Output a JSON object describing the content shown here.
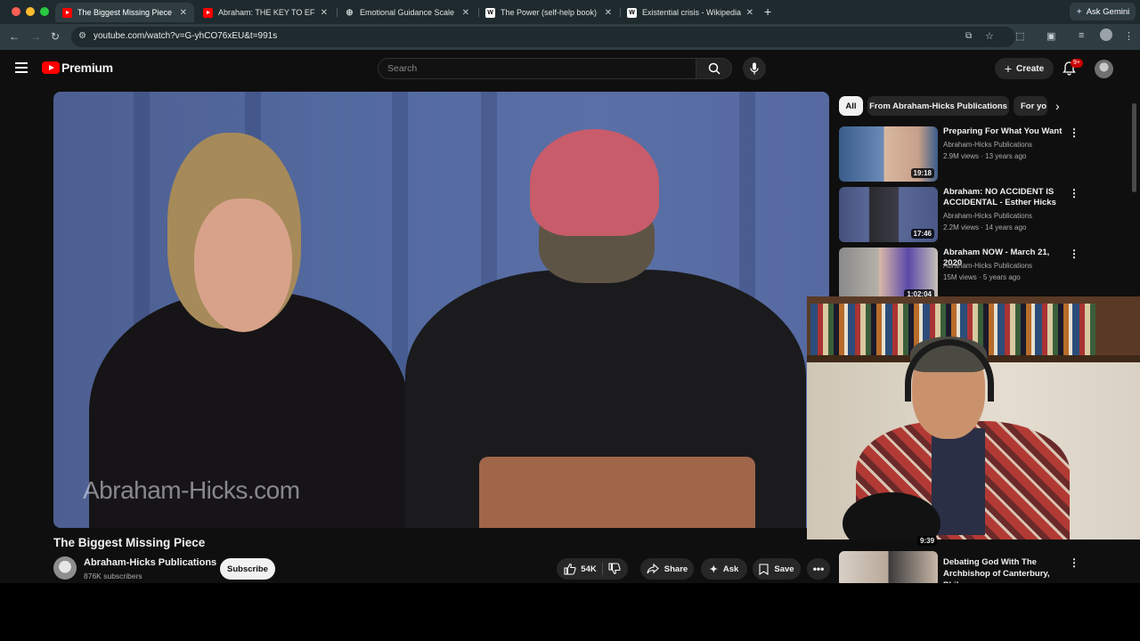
{
  "browser": {
    "tabs": [
      {
        "title": "The Biggest Missing Piece - Y",
        "favicon": "youtube-icon",
        "active": true
      },
      {
        "title": "Abraham: THE KEY TO EFFOR",
        "favicon": "youtube-icon",
        "active": false
      },
      {
        "title": "Emotional Guidance Scale - H",
        "favicon": "globe-icon",
        "active": false
      },
      {
        "title": "The Power (self-help book) -",
        "favicon": "wikipedia-icon",
        "active": false
      },
      {
        "title": "Existential crisis - Wikipedia",
        "favicon": "wikipedia-icon",
        "active": false
      }
    ],
    "url": "youtube.com/watch?v=G-yhCO76xEU&t=991s",
    "ask_gemini": "Ask Gemini"
  },
  "youtube": {
    "logo_text": "Premium",
    "search_placeholder": "Search",
    "create_label": "Create",
    "notification_count": "9+",
    "video": {
      "watermark": "Abraham-Hicks.com",
      "title": "The Biggest Missing Piece",
      "channel": "Abraham-Hicks Publications",
      "subscribers": "876K subscribers",
      "subscribe_label": "Subscribe",
      "likes": "54K",
      "share_label": "Share",
      "ask_label": "Ask",
      "save_label": "Save"
    },
    "chips": [
      "All",
      "From Abraham-Hicks Publications",
      "For yo"
    ],
    "recommendations": [
      {
        "title": "Preparing For What You Want",
        "channel": "Abraham-Hicks Publications",
        "meta": "2.9M views · 13 years ago",
        "duration": "19:18"
      },
      {
        "title": "Abraham: NO ACCIDENT IS ACCIDENTAL - Esther Hicks",
        "channel": "Abraham-Hicks Publications",
        "meta": "2.2M views · 14 years ago",
        "duration": "17:46"
      },
      {
        "title": "Abraham NOW - March 21, 2020",
        "channel": "Abraham-Hicks Publications",
        "meta": "15M views · 5 years ago",
        "duration": "1:02:04"
      }
    ],
    "recommendation_lower": {
      "title": "Debating God With The Archbishop of Canterbury, Phil...",
      "duration": "9:39"
    }
  }
}
